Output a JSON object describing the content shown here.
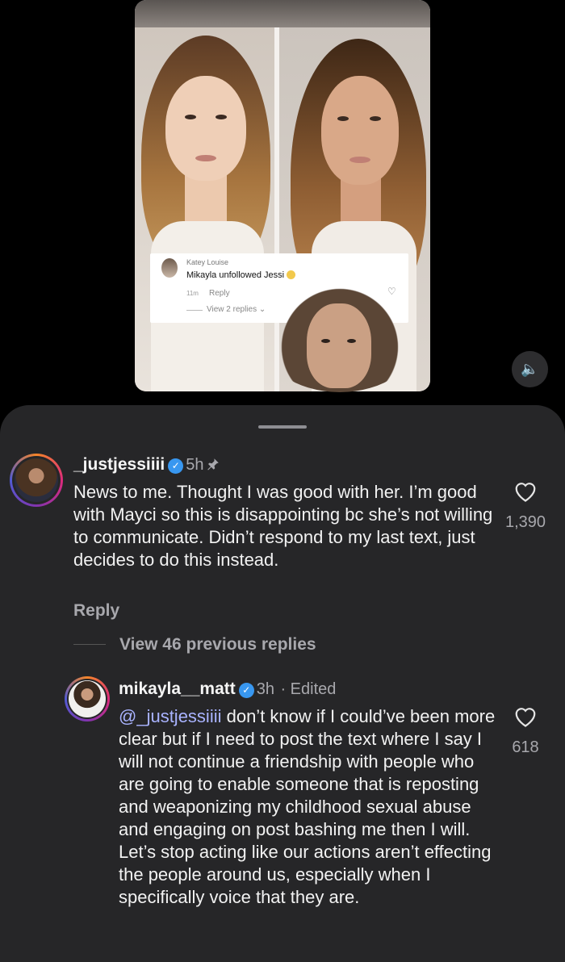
{
  "video": {
    "overlay_comment": {
      "author": "Katey Louise",
      "text": "Mikayla unfollowed Jessi",
      "time": "11m",
      "reply_label": "Reply",
      "view_replies": "View 2 replies"
    },
    "sound_icon": "speaker-icon"
  },
  "comments": [
    {
      "username": "_justjessiiii",
      "time": "5h",
      "pinned": true,
      "text": "News to me. Thought I was good with her. I’m good with Mayci so this is disappointing bc she’s not willing to communicate. Didn’t respond to my last text, just decides to do this instead.",
      "like_count": "1,390",
      "reply_label": "Reply"
    }
  ],
  "view_previous": "View 46 previous replies",
  "reply": {
    "username": "mikayla__matt",
    "time": "3h",
    "edited": "· Edited",
    "mention": "@_justjessiiii",
    "text": " don’t know if I could’ve been more clear but if I need to post the text where I say I will not continue a friendship with people who are going to enable someone that is reposting and weaponizing my childhood sexual abuse and engaging on post bashing me then I will. Let’s stop acting like our actions aren’t effecting the people around us, especially when I specifically voice that they are.",
    "like_count": "618"
  }
}
